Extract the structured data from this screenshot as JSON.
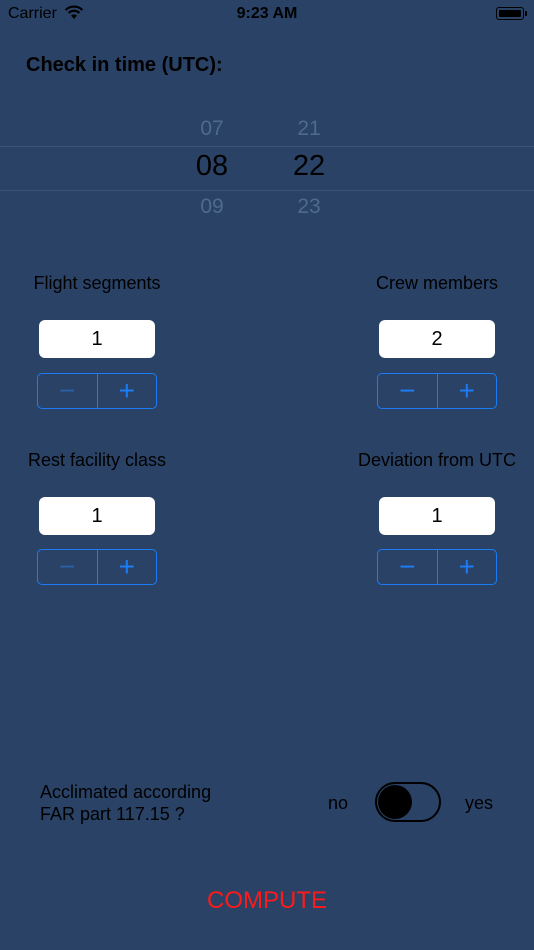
{
  "status_bar": {
    "carrier": "Carrier",
    "time": "9:23 AM"
  },
  "title": "Check in time (UTC):",
  "picker": {
    "hours": {
      "above": "07",
      "selected": "08",
      "below": "09"
    },
    "minutes": {
      "above": "21",
      "selected": "22",
      "below": "23"
    }
  },
  "fields": {
    "flight_segments": {
      "label": "Flight segments",
      "value": "1",
      "minus": "−",
      "plus": "+"
    },
    "crew_members": {
      "label": "Crew members",
      "value": "2",
      "minus": "−",
      "plus": "+"
    },
    "rest_facility_class": {
      "label": "Rest facility class",
      "value": "1",
      "minus": "−",
      "plus": "+"
    },
    "deviation_from_utc": {
      "label": "Deviation from UTC",
      "value": "1",
      "minus": "−",
      "plus": "+"
    }
  },
  "acclimated": {
    "question_line1": "Acclimated according",
    "question_line2": "FAR part 117.15 ?",
    "no_label": "no",
    "yes_label": "yes",
    "toggle_on": false
  },
  "compute_label": "COMPUTE",
  "colors": {
    "background": "#294266",
    "accent": "#1b7cf5",
    "compute": "#ff1a1a"
  },
  "icons": {
    "wifi": "wifi-icon",
    "battery": "battery-icon"
  }
}
